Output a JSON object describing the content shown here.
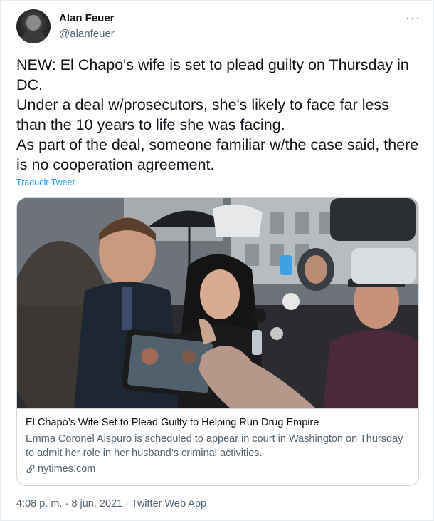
{
  "author": {
    "name": "Alan Feuer",
    "handle": "@alanfeuer",
    "avatar_icon": "profile-photo"
  },
  "menu": {
    "more_label": "···"
  },
  "tweet": {
    "lines": [
      "NEW: El Chapo's wife is set to plead guilty on Thursday in DC.",
      "Under a deal w/prosecutors, she's likely to face far less than the 10 years to life she was facing.",
      "As part of the deal, someone familiar w/the case said, there is no cooperation agreement."
    ],
    "translate_label": "Traducir Tweet"
  },
  "card": {
    "title": "El Chapo’s Wife Set to Plead Guilty to Helping Run Drug Empire",
    "description": "Emma Coronel Aispuro is scheduled to appear in court in Washington on Thursday to admit her role in her husband’s criminal activities.",
    "domain": "nytimes.com",
    "domain_icon": "link-icon"
  },
  "footer": {
    "time": "4:08 p. m.",
    "separator": " · ",
    "date": "8 jun. 2021",
    "source": "Twitter Web App"
  },
  "colors": {
    "link_blue": "#1d9bf0",
    "text_primary": "#0f1419",
    "text_secondary": "#536471",
    "border": "#cfd9de"
  }
}
